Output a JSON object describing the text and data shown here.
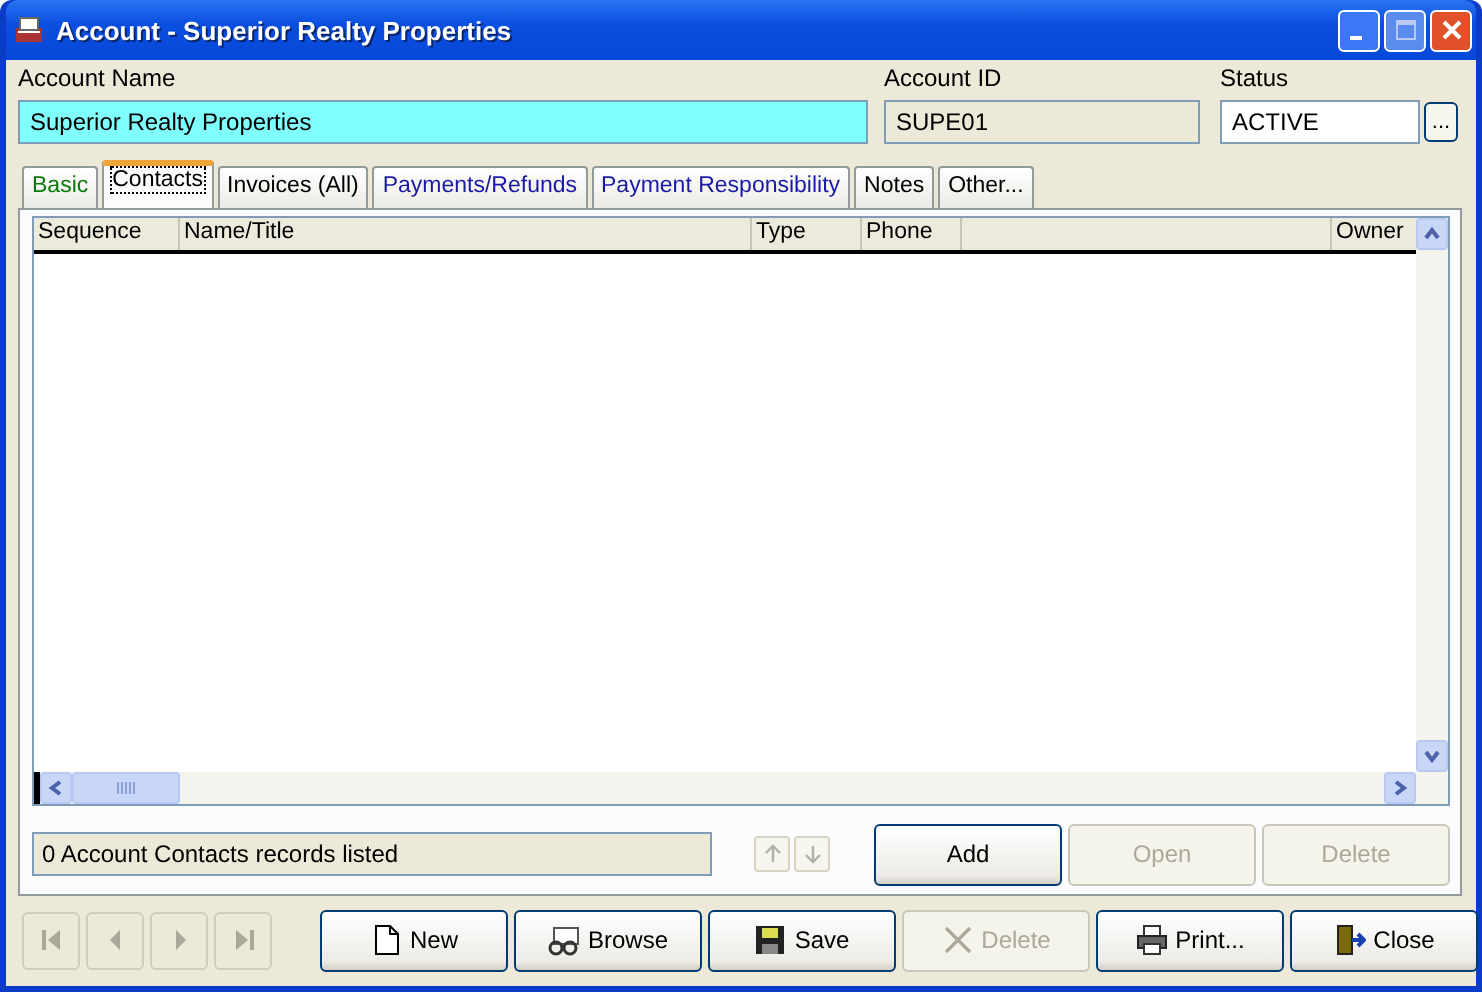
{
  "window": {
    "title": "Account  - Superior Realty Properties"
  },
  "header": {
    "fields": [
      {
        "label": "Account Name",
        "value": "Superior Realty Properties",
        "kind": "highlight"
      },
      {
        "label": "Account ID",
        "value": "SUPE01",
        "kind": "readonly"
      },
      {
        "label": "Status",
        "value": "ACTIVE",
        "kind": "picker",
        "button": "..."
      }
    ]
  },
  "tabs": [
    {
      "label": "Basic",
      "selected": false,
      "color": "#0a7a0a"
    },
    {
      "label": "Contacts",
      "selected": true,
      "color": "#000000"
    },
    {
      "label": "Invoices (All)",
      "selected": false,
      "color": "#000000"
    },
    {
      "label": "Payments/Refunds",
      "selected": false,
      "color": "#1a1aa6"
    },
    {
      "label": "Payment Responsibility",
      "selected": false,
      "color": "#1a1aa6"
    },
    {
      "label": "Notes",
      "selected": false,
      "color": "#000000"
    },
    {
      "label": "Other...",
      "selected": false,
      "color": "#000000"
    }
  ],
  "table": {
    "columns": [
      "Sequence",
      "Name/Title",
      "Type",
      "Phone",
      "",
      "Owner"
    ]
  },
  "status": "0 Account Contacts records listed",
  "list_buttons": [
    {
      "label": "Add",
      "disabled": false
    },
    {
      "label": "Open",
      "disabled": true
    },
    {
      "label": "Delete",
      "disabled": true
    }
  ],
  "nav_buttons": [
    {
      "kind": "first",
      "disabled": true
    },
    {
      "kind": "prev",
      "disabled": true
    },
    {
      "kind": "next",
      "disabled": true
    },
    {
      "kind": "last",
      "disabled": true
    }
  ],
  "toolbar": [
    {
      "kind": "new",
      "label": "New",
      "disabled": false
    },
    {
      "kind": "browse",
      "label": "Browse",
      "disabled": false
    },
    {
      "kind": "save",
      "label": "Save",
      "disabled": false
    },
    {
      "kind": "delete",
      "label": "Delete",
      "disabled": true
    },
    {
      "kind": "print",
      "label": "Print...",
      "disabled": false
    },
    {
      "kind": "close",
      "label": "Close",
      "disabled": false
    }
  ]
}
